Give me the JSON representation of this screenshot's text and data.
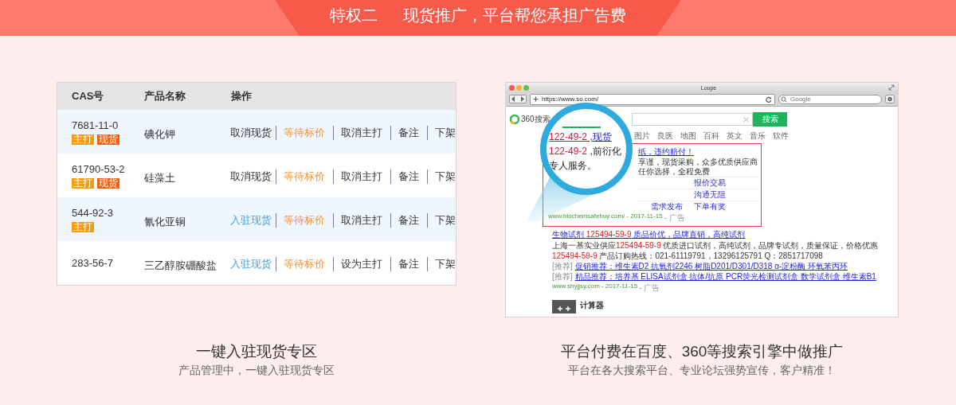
{
  "banner": {
    "label": "特权二",
    "title": "现货推广，平台帮您承担广告费"
  },
  "table": {
    "columns": [
      "CAS号",
      "产品名称",
      "操作"
    ],
    "rows": [
      {
        "cas": "7681-11-0",
        "name": "碘化钾",
        "tags": [
          {
            "label": "主打",
            "kind": "main"
          },
          {
            "label": "现货",
            "kind": "stock"
          }
        ],
        "actions": [
          {
            "label": "取消现货",
            "kind": "plain"
          },
          {
            "label": "等待标价",
            "kind": "pending"
          },
          {
            "label": "取消主打",
            "kind": "plain"
          },
          {
            "label": "备注",
            "kind": "plain"
          },
          {
            "label": "下架",
            "kind": "plain"
          }
        ]
      },
      {
        "cas": "61790-53-2",
        "name": "硅藻土",
        "tags": [
          {
            "label": "主打",
            "kind": "main"
          },
          {
            "label": "现货",
            "kind": "stock"
          }
        ],
        "actions": [
          {
            "label": "取消现货",
            "kind": "plain"
          },
          {
            "label": "等待标价",
            "kind": "pending"
          },
          {
            "label": "取消主打",
            "kind": "plain"
          },
          {
            "label": "备注",
            "kind": "plain"
          },
          {
            "label": "下架",
            "kind": "plain"
          }
        ]
      },
      {
        "cas": "544-92-3",
        "name": "氰化亚铜",
        "tags": [
          {
            "label": "主打",
            "kind": "main"
          }
        ],
        "actions": [
          {
            "label": "入驻现货",
            "kind": "join"
          },
          {
            "label": "等待标价",
            "kind": "pending"
          },
          {
            "label": "取消主打",
            "kind": "plain"
          },
          {
            "label": "备注",
            "kind": "plain"
          },
          {
            "label": "下架",
            "kind": "plain"
          }
        ]
      },
      {
        "cas": "283-56-7",
        "name": "三乙醇胺硼酸盐",
        "tags": [],
        "actions": [
          {
            "label": "入驻现货",
            "kind": "join"
          },
          {
            "label": "等待标价",
            "kind": "pending"
          },
          {
            "label": "设为主打",
            "kind": "plain"
          },
          {
            "label": "备注",
            "kind": "plain"
          },
          {
            "label": "下架",
            "kind": "plain"
          }
        ]
      }
    ]
  },
  "left_caption": {
    "title": "一键入驻现货专区",
    "subtitle": "产品管理中，一键入驻现货专区"
  },
  "browser": {
    "title": "Loupe",
    "url": "https://www.so.com/",
    "search_placeholder": "Google",
    "logo": "360搜索",
    "search_button": "搜索",
    "tabs": [
      "图片",
      "良医",
      "地图",
      "百科",
      "英文",
      "音乐",
      "软件"
    ],
    "ad": {
      "title": "纸，违约赔付！",
      "description": "享谨，现货采购，众多优质供应商任你选择，全程免费",
      "link_rows": [
        [
          "报价交易"
        ],
        [
          "沟通无阻"
        ],
        [
          "需求发布",
          "下单有奖"
        ]
      ],
      "url": "www.biochemsafebuy.com/",
      "date": "- 2017-11-15",
      "tag": "- 广告"
    },
    "result": {
      "title": [
        {
          "text": "生物试剂 ",
          "highlight": false
        },
        {
          "text": "125494-59-9",
          "highlight": true
        },
        {
          "text": " 质品价优，品牌直销，高纯试剂",
          "highlight": false
        }
      ],
      "lines": [
        [
          {
            "text": "上海一基实业供应",
            "highlight": false
          },
          {
            "text": "125494-59-9",
            "highlight": true
          },
          {
            "text": " 优质进口试剂，高纯试剂，品牌专试剂，质量保证，价格优惠",
            "highlight": false
          }
        ],
        [
          {
            "text": "125494-59-9",
            "highlight": true
          },
          {
            "text": " 产品订购热线：021-61119791，13296125791 Q：2851717098",
            "highlight": false
          }
        ]
      ],
      "promos": [
        {
          "tag": "[推荐]",
          "text": "促销推荐：维生素D2 抗氧剂2246 树脂D201/D301/D318 α-淀粉酶 环氧苯丙环"
        },
        {
          "tag": "[推荐]",
          "text": "精品推荐：培养基 ELISA试剂盒 抗体/抗原 PCR荧光检测试剂盒 数学试剂盒 维生素B1"
        }
      ],
      "url": "www.shyjjsy.com",
      "date": "- 2017-11-15",
      "tag": "- 广告"
    },
    "calculator": {
      "title": "计算器"
    },
    "magnifier": {
      "lines": [
        {
          "cas": "122-49-2",
          "text": " ,现货",
          "kind": "title"
        },
        {
          "cas": "122-49-2",
          "text": " ,前衍化",
          "kind": "body"
        },
        {
          "text": "专人服务。",
          "kind": "body"
        }
      ]
    }
  },
  "right_caption": {
    "title": "平台付费在百度、360等搜索引擎中做推广",
    "subtitle": "平台在各大搜索平台、专业论坛强势宣传，客户精准！"
  }
}
